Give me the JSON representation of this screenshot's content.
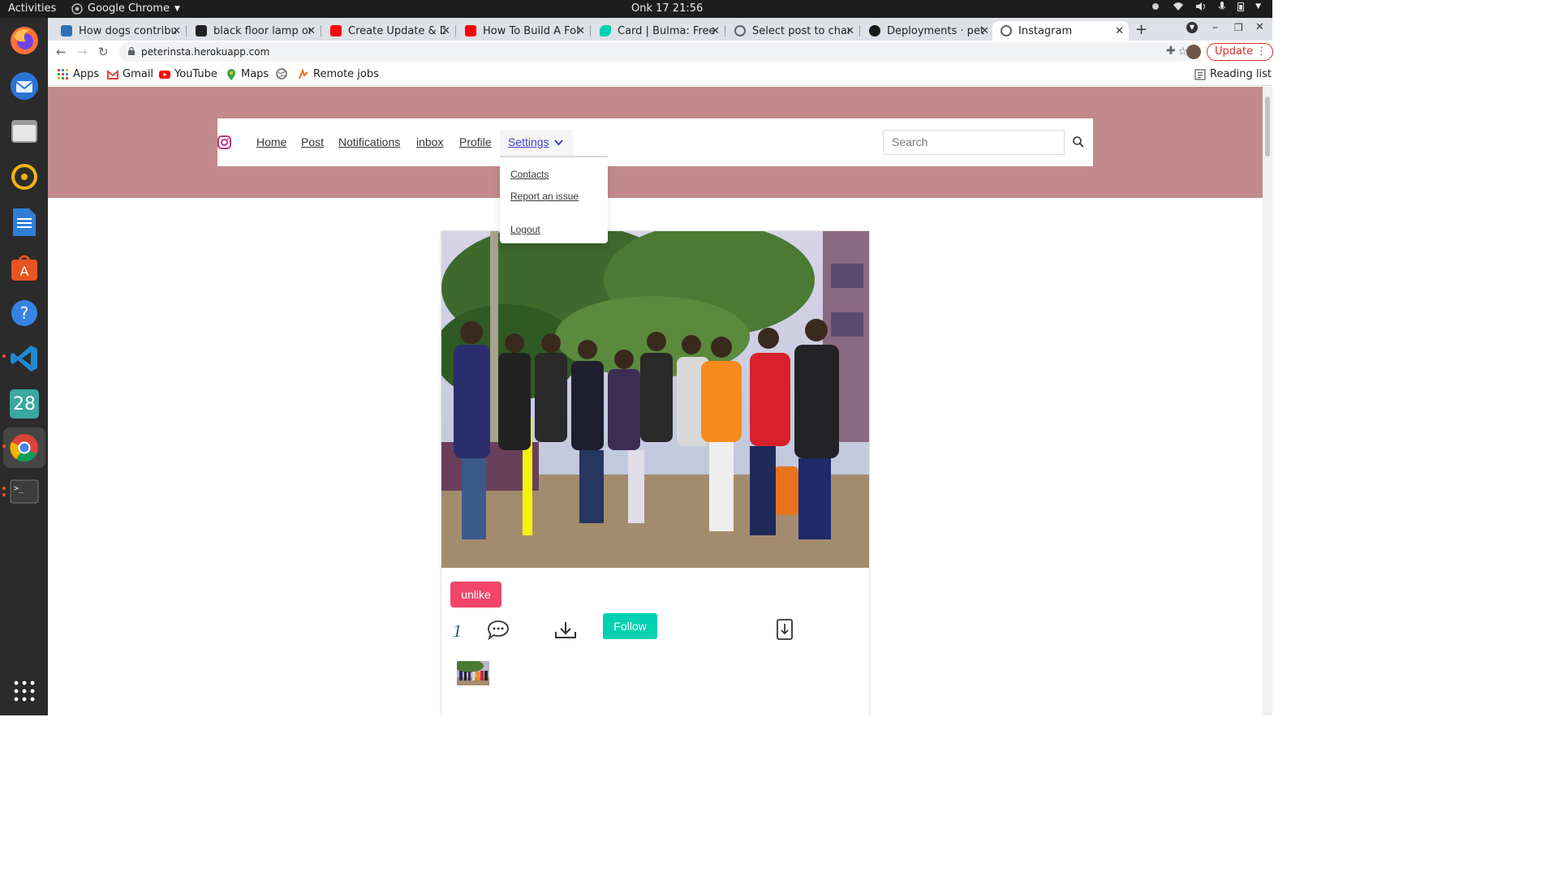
{
  "system": {
    "activities": "Activities",
    "app_name": "Google Chrome",
    "clock": "Onk 17  21:56"
  },
  "dock": {
    "calendar_date": "28"
  },
  "browser": {
    "tabs": [
      {
        "title": "How dogs contribut",
        "favicon_color": "#2a6fb8"
      },
      {
        "title": "black floor lamp on",
        "favicon_color": "#222222"
      },
      {
        "title": "Create Update & De",
        "favicon_color": "#ff0000"
      },
      {
        "title": "How To Build A Follo",
        "favicon_color": "#ff0000"
      },
      {
        "title": "Card | Bulma: Free, o",
        "favicon_color": "#00d1b2"
      },
      {
        "title": "Select post to chang",
        "favicon_color": "#5f6368"
      },
      {
        "title": "Deployments · peter",
        "favicon_color": "#181717"
      },
      {
        "title": "Instagram",
        "favicon_color": "#5f6368"
      }
    ],
    "url": "peterinsta.herokuapp.com",
    "update_label": "Update",
    "bookmarks": [
      {
        "label": "Apps"
      },
      {
        "label": "Gmail"
      },
      {
        "label": "YouTube"
      },
      {
        "label": "Maps"
      },
      {
        "label": ""
      },
      {
        "label": "Remote jobs"
      }
    ],
    "reading_list": "Reading list"
  },
  "navbar": {
    "links": [
      "Home",
      "Post",
      "Notifications",
      "inbox",
      "Profile"
    ],
    "settings_label": "Settings",
    "search_placeholder": "Search"
  },
  "dropdown": {
    "items": [
      "Contacts",
      "Report an issue",
      "Logout"
    ]
  },
  "post": {
    "unlike_label": "unlike",
    "like_count": "1",
    "follow_label": "Follow"
  },
  "colors": {
    "hero_bg": "#c28a8c",
    "unlike_bg": "#f14668",
    "follow_bg": "#00d1b2",
    "settings_link": "#3e3ecf",
    "instagram_icon": "#c13584"
  }
}
